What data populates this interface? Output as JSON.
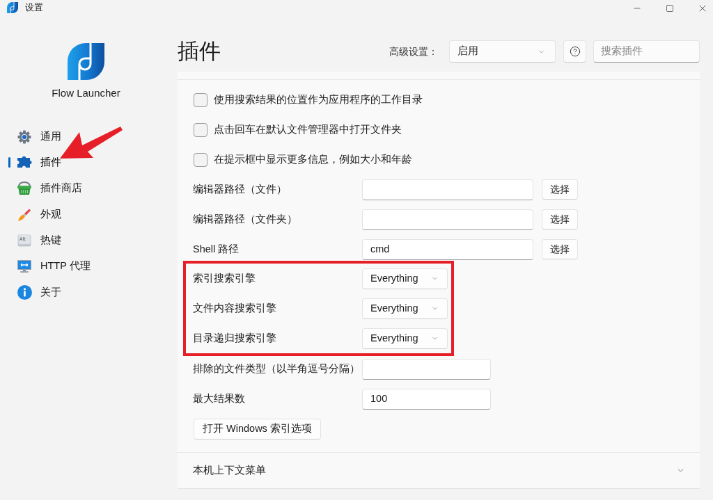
{
  "window": {
    "title": "设置"
  },
  "sidebar": {
    "app_name": "Flow Launcher",
    "items": [
      {
        "label": "通用",
        "kind": "gear",
        "selected": false
      },
      {
        "label": "插件",
        "kind": "puzzle",
        "selected": true
      },
      {
        "label": "插件商店",
        "kind": "basket",
        "selected": false
      },
      {
        "label": "外观",
        "kind": "brush",
        "selected": false
      },
      {
        "label": "热键",
        "kind": "key",
        "key_label": "Alt",
        "selected": false
      },
      {
        "label": "HTTP 代理",
        "kind": "monitor",
        "selected": false
      },
      {
        "label": "关于",
        "kind": "info",
        "selected": false
      }
    ]
  },
  "header": {
    "title": "插件",
    "advanced_label": "高级设置：",
    "advanced_value": "启用",
    "search_placeholder": "搜索插件"
  },
  "settings": [
    {
      "kind": "checkbox",
      "label": "使用搜索结果的位置作为应用程序的工作目录",
      "checked": false,
      "highlighted": false
    },
    {
      "kind": "checkbox",
      "label": "点击回车在默认文件管理器中打开文件夹",
      "checked": false,
      "highlighted": false
    },
    {
      "kind": "checkbox",
      "label": "在提示框中显示更多信息，例如大小和年龄",
      "checked": false,
      "highlighted": false
    },
    {
      "kind": "path",
      "label": "编辑器路径（文件）",
      "button": "选择",
      "highlighted": false
    },
    {
      "kind": "path",
      "label": "编辑器路径（文件夹）",
      "button": "选择",
      "highlighted": false
    },
    {
      "kind": "path",
      "label": "Shell 路径",
      "value": "cmd",
      "button": "选择",
      "highlighted": false
    },
    {
      "kind": "select",
      "label": "索引搜索引擎",
      "value": "Everything",
      "highlighted": true
    },
    {
      "kind": "select",
      "label": "文件内容搜索引擎",
      "value": "Everything",
      "highlighted": true
    },
    {
      "kind": "select",
      "label": "目录递归搜索引擎",
      "value": "Everything",
      "highlighted": true
    },
    {
      "kind": "text",
      "label": "排除的文件类型（以半角逗号分隔）",
      "highlighted": false
    },
    {
      "kind": "text",
      "label": "最大结果数",
      "value": "100",
      "highlighted": false
    },
    {
      "kind": "button",
      "label": "打开 Windows 索引选项",
      "highlighted": false
    }
  ],
  "expander": {
    "label": "本机上下文菜单",
    "expanded": false
  }
}
